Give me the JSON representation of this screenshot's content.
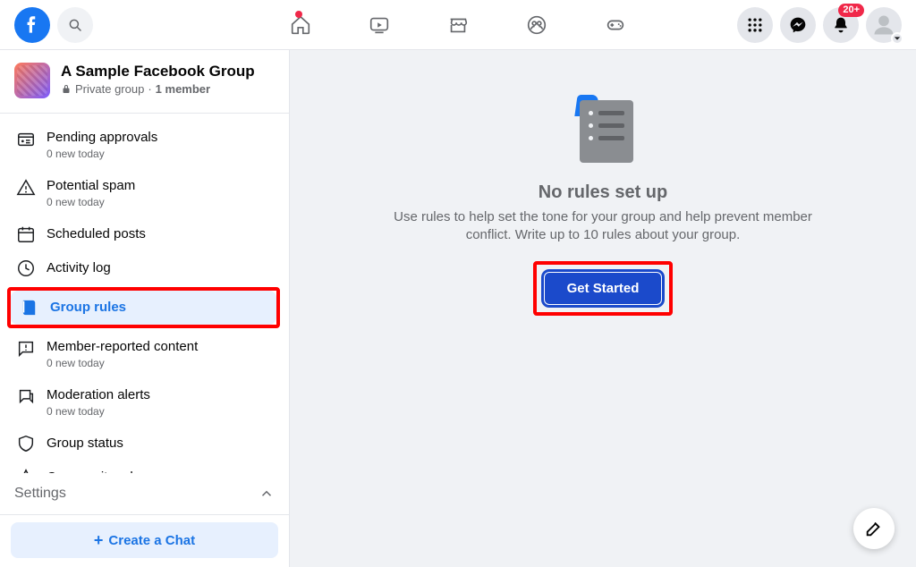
{
  "header": {
    "notification_count": "20+"
  },
  "group": {
    "title": "A Sample Facebook Group",
    "privacy": "Private group",
    "members": "1 member"
  },
  "sidebar": {
    "items": [
      {
        "icon": "pending",
        "label": "Pending approvals",
        "sub": "0 new today",
        "selected": false
      },
      {
        "icon": "warning",
        "label": "Potential spam",
        "sub": "0 new today",
        "selected": false
      },
      {
        "icon": "calendar",
        "label": "Scheduled posts",
        "sub": null,
        "selected": false
      },
      {
        "icon": "clock",
        "label": "Activity log",
        "sub": null,
        "selected": false
      },
      {
        "icon": "book",
        "label": "Group rules",
        "sub": null,
        "selected": true
      },
      {
        "icon": "flag",
        "label": "Member-reported content",
        "sub": "0 new today",
        "selected": false
      },
      {
        "icon": "alert-flag",
        "label": "Moderation alerts",
        "sub": "0 new today",
        "selected": false
      },
      {
        "icon": "shield",
        "label": "Group status",
        "sub": null,
        "selected": false
      },
      {
        "icon": "roles",
        "label": "Community roles",
        "sub": null,
        "selected": false
      }
    ],
    "settings_label": "Settings",
    "create_chat": "Create a Chat"
  },
  "main": {
    "empty_title": "No rules set up",
    "empty_desc": "Use rules to help set the tone for your group and help prevent member conflict. Write up to 10 rules about your group.",
    "cta": "Get Started"
  }
}
